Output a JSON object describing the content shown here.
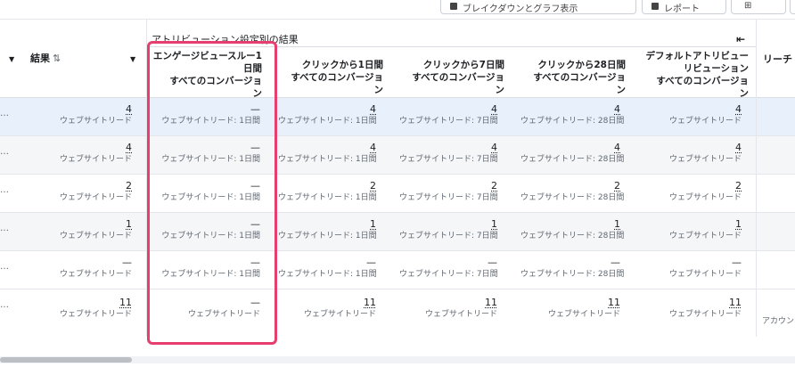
{
  "toolbar": {
    "buttons": [
      {
        "label": "ブレイクダウンとグラフ表示"
      },
      {
        "label": "レポート"
      },
      {
        "label": "⊞"
      },
      {
        "label": ""
      }
    ]
  },
  "header": {
    "results_label": "結果",
    "results_sort": "⇅",
    "group_title": "アトリビューション設定別の結果",
    "collapse_icon": "⇤",
    "reach_label": "リーチ ↑",
    "columns": [
      {
        "line1": "エンゲージビュースルー1",
        "line2": "日間",
        "line3": "すべてのコンバージョ",
        "line4": "ン"
      },
      {
        "line1": "クリックから1日間",
        "line2": "すべてのコンバージョ",
        "line3": "ン"
      },
      {
        "line1": "クリックから7日間",
        "line2": "すべてのコンバージョ",
        "line3": "ン"
      },
      {
        "line1": "クリックから28日間",
        "line2": "すべてのコンバージョ",
        "line3": "ン"
      },
      {
        "line1": "デフォルトアトリビュー",
        "line2": "リビューション",
        "line3": "すべてのコンバージョ",
        "line4": "ン"
      }
    ]
  },
  "rows": [
    {
      "dots": "…",
      "results": "4",
      "results_sub": "ウェブサイトリード",
      "cells": [
        {
          "v": "—",
          "s": "ウェブサイトリード: 1日間"
        },
        {
          "v": "4",
          "s": "ウェブサイトリード: 1日間"
        },
        {
          "v": "4",
          "s": "ウェブサイトリード: 7日間"
        },
        {
          "v": "4",
          "s": "ウェブサイトリード: 28日間"
        },
        {
          "v": "4",
          "s": "ウェブサイトリード"
        }
      ]
    },
    {
      "dots": "…",
      "results": "4",
      "results_sub": "ウェブサイトリード",
      "cells": [
        {
          "v": "—",
          "s": "ウェブサイトリード: 1日間"
        },
        {
          "v": "4",
          "s": "ウェブサイトリード: 1日間"
        },
        {
          "v": "4",
          "s": "ウェブサイトリード: 7日間"
        },
        {
          "v": "4",
          "s": "ウェブサイトリード: 28日間"
        },
        {
          "v": "4",
          "s": "ウェブサイトリード"
        }
      ]
    },
    {
      "dots": "…",
      "results": "2",
      "results_sub": "ウェブサイトリード",
      "cells": [
        {
          "v": "—",
          "s": "ウェブサイトリード: 1日間"
        },
        {
          "v": "2",
          "s": "ウェブサイトリード: 1日間"
        },
        {
          "v": "2",
          "s": "ウェブサイトリード: 7日間"
        },
        {
          "v": "2",
          "s": "ウェブサイトリード: 28日間"
        },
        {
          "v": "2",
          "s": "ウェブサイトリード"
        }
      ]
    },
    {
      "dots": "…",
      "results": "1",
      "results_sub": "ウェブサイトリード",
      "cells": [
        {
          "v": "—",
          "s": "ウェブサイトリード: 1日間"
        },
        {
          "v": "1",
          "s": "ウェブサイトリード: 1日間"
        },
        {
          "v": "1",
          "s": "ウェブサイトリード: 7日間"
        },
        {
          "v": "1",
          "s": "ウェブサイトリード: 28日間"
        },
        {
          "v": "1",
          "s": "ウェブサイトリード"
        }
      ]
    },
    {
      "dots": "…",
      "results": "—",
      "results_sub": "ウェブサイトリード",
      "cells": [
        {
          "v": "—",
          "s": "ウェブサイトリード: 1日間"
        },
        {
          "v": "—",
          "s": "ウェブサイトリード: 1日間"
        },
        {
          "v": "—",
          "s": "ウェブサイトリード: 7日間"
        },
        {
          "v": "—",
          "s": "ウェブサイトリード: 28日間"
        },
        {
          "v": "—",
          "s": "ウェブサイトリード"
        }
      ]
    },
    {
      "dots": "…",
      "results": "11",
      "results_sub": "ウェブサイトリード",
      "reach_sub": "アカウントセン",
      "cells": [
        {
          "v": "—",
          "s": "ウェブサイトリード"
        },
        {
          "v": "11",
          "s": "ウェブサイトリード"
        },
        {
          "v": "11",
          "s": "ウェブサイトリード"
        },
        {
          "v": "11",
          "s": "ウェブサイトリード"
        },
        {
          "v": "11",
          "s": "ウェブサイトリード"
        }
      ]
    }
  ],
  "colors": {
    "highlight": "#e63e6e",
    "selected_row": "#e7f0fb"
  }
}
